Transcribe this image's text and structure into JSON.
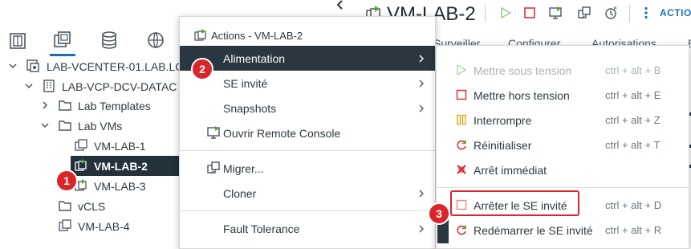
{
  "header": {
    "title": "VM-LAB-2",
    "actions_label": "ACTIO",
    "tabs": [
      "Surveiller",
      "Configurer",
      "Autorisations",
      "E"
    ]
  },
  "tree": {
    "vcenter": "LAB-VCENTER-01.LAB.LO",
    "datacenter": "LAB-VCP-DCV-DATAC",
    "lab_templates": "Lab Templates",
    "lab_vms": "Lab VMs",
    "vm1": "VM-LAB-1",
    "vm2": "VM-LAB-2",
    "vm3": "VM-LAB-3",
    "vcls": "vCLS",
    "vm4": "VM-LAB-4"
  },
  "actions_menu": {
    "title": "Actions - VM-LAB-2",
    "alimentation": "Alimentation",
    "se_invite": "SE invité",
    "snapshots": "Snapshots",
    "remote_console": "Ouvrir Remote Console",
    "migrer": "Migrer...",
    "cloner": "Cloner",
    "fault_tolerance": "Fault Tolerance"
  },
  "power_menu": {
    "power_on": "Mettre sous tension",
    "power_on_sc": "ctrl + alt + B",
    "power_off": "Mettre hors tension",
    "power_off_sc": "ctrl + alt + E",
    "suspend": "Interrompre",
    "suspend_sc": "ctrl + alt + Z",
    "reset": "Réinitialiser",
    "reset_sc": "ctrl + alt + T",
    "hard_stop": "Arrêt immédiat",
    "shutdown_guest": "Arrêter le SE invité",
    "shutdown_guest_sc": "ctrl + alt + D",
    "restart_guest": "Redémarrer le SE invité",
    "restart_guest_sc": "ctrl + alt + R"
  },
  "callouts": {
    "one": "1",
    "two": "2",
    "three": "3"
  },
  "colors": {
    "accent": "#1b6fb8",
    "selected": "#23313b",
    "callout": "#d9262c",
    "green": "#5aa33a"
  }
}
